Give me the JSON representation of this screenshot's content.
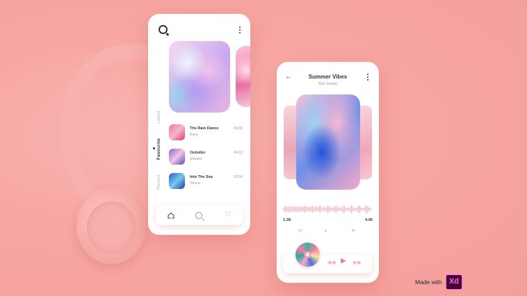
{
  "colors": {
    "background": "#f7a5a1",
    "accent": "#f27a8c"
  },
  "phone1": {
    "icons": {
      "logo": "q-logo-icon",
      "menu": "kebab-menu-icon"
    },
    "tabs": [
      {
        "label": "Latest"
      },
      {
        "label": "Favourite",
        "active": true
      },
      {
        "label": "Recent"
      }
    ],
    "tracks": [
      {
        "title": "The Rain Dance",
        "artist": "Kiara",
        "duration": "06:00"
      },
      {
        "title": "Outsider",
        "artist": "Edward",
        "duration": "04:10"
      },
      {
        "title": "Into The Sea",
        "artist": "Henna",
        "duration": "03:56"
      }
    ],
    "nav": {
      "home": "home-icon",
      "search": "search-icon",
      "favourites": "heart-icon"
    }
  },
  "phone2": {
    "title": "Summer Vibes",
    "artist": "Nick Joseph",
    "time_elapsed": "1:28",
    "time_total": "4:05",
    "controls": [
      "repeat-icon",
      "volume-icon",
      "heart-icon"
    ],
    "player_controls": [
      "previous-icon",
      "play-icon",
      "next-icon"
    ]
  },
  "footer": {
    "made_with": "Made with",
    "xd_logo": "Xd"
  }
}
